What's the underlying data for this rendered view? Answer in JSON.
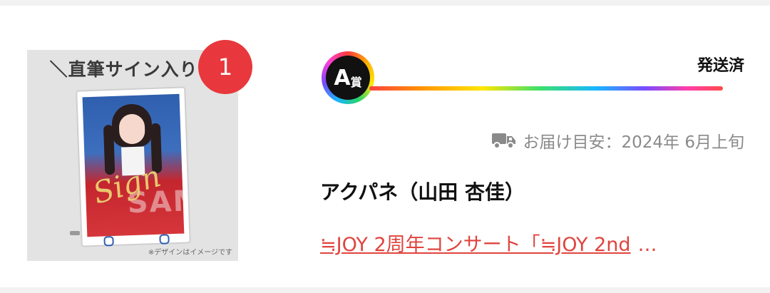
{
  "item": {
    "thumbnail": {
      "caption": "＼直筆サイン入り!!",
      "sign_text": "Sign",
      "watermark": "SAMPLE",
      "disclaimer": "※デザインはイメージです"
    },
    "count_badge": "1",
    "prize": {
      "letter": "A",
      "suffix": "賞"
    },
    "status": "発送済",
    "delivery": {
      "icon": "truck-icon",
      "label": "お届け目安：",
      "date": "2024年 6月上旬"
    },
    "artist": "アクパネ（山田 杏佳）",
    "event": {
      "text": "≒JOY 2周年コンサート「≒JOY 2nd",
      "ellipsis": "…"
    }
  },
  "colors": {
    "badge": "#e8383d",
    "link": "#e0443e",
    "muted": "#8a8a8a"
  }
}
